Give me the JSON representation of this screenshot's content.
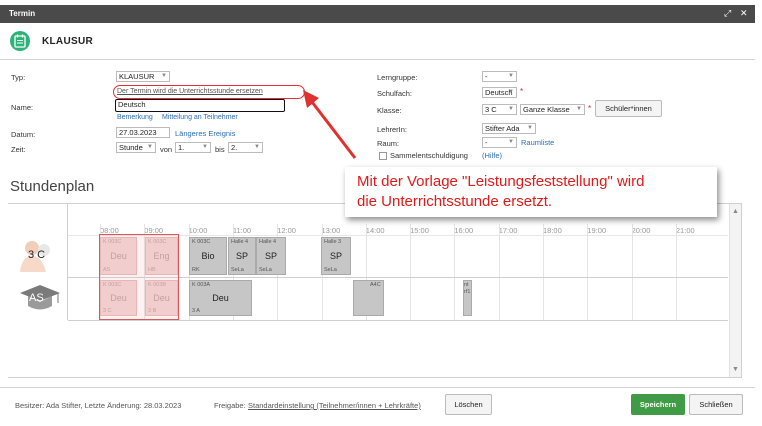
{
  "window": {
    "title": "Termin"
  },
  "header": {
    "title": "KLAUSUR"
  },
  "form": {
    "typ_label": "Typ:",
    "typ_value": "KLAUSUR",
    "replace_link": "Der Termin wird die Unterrichtsstunde ersetzen",
    "name_label": "Name:",
    "name_value": "Deutsch",
    "bemerkung_link": "Bemerkung",
    "mitteilung_link": "Mitteilung an Teilnehmer",
    "datum_label": "Datum:",
    "datum_value": "27.03.2023",
    "laengeres_link": "Längeres Ereignis",
    "zeit_label": "Zeit:",
    "zeit_mode": "Stunde",
    "von_label": "von",
    "von_value": "1.",
    "bis_label": "bis",
    "bis_value": "2.",
    "lerngruppe_label": "Lerngruppe:",
    "lerngruppe_value": "-",
    "schulfach_label": "Schulfach:",
    "schulfach_value": "Deutsch",
    "klasse_label": "Klasse:",
    "klasse_value": "3 C",
    "klasse_mode": "Ganze Klasse",
    "schueler_button": "Schüler*innen",
    "lehrerin_label": "LehrerIn:",
    "lehrerin_value": "Stifter Ada",
    "raum_label": "Raum:",
    "raum_value": "-",
    "raumliste_link": "Raumliste",
    "sammel_label": "Sammelentschuldigung",
    "hilfe_link": "(Hilfe)",
    "required_mark": "*"
  },
  "timetable": {
    "title": "Stundenplan",
    "hours": [
      "08:00",
      "09:00",
      "10:00",
      "11:00",
      "12:00",
      "13:00",
      "14:00",
      "15:00",
      "16:00",
      "17:00",
      "18:00",
      "19:00",
      "20:00",
      "21:00"
    ],
    "rows": [
      {
        "label": "3 C",
        "blocks": [
          {
            "room": "K 003C",
            "subject": "Deu",
            "teacher": "AS",
            "ghost": true
          },
          {
            "room": "K 003C",
            "subject": "Eng",
            "teacher": "HB",
            "ghost": true
          },
          {
            "room": "K 003C",
            "subject": "Bio",
            "teacher": "RK",
            "ghost": false
          },
          {
            "room": "Halle 4",
            "subject": "SP",
            "teacher": "SeLa",
            "ghost": false
          },
          {
            "room": "Halle 4",
            "subject": "SP",
            "teacher": "SeLa",
            "ghost": false
          },
          {
            "room": "Halle 3",
            "subject": "SP",
            "teacher": "SeLa",
            "ghost": false
          }
        ]
      },
      {
        "label": "AS",
        "blocks": [
          {
            "room": "K 003C",
            "subject": "Deu",
            "teacher": "3 C",
            "ghost": true
          },
          {
            "room": "K 003B",
            "subject": "Deu",
            "teacher": "3 B",
            "ghost": true
          },
          {
            "room": "K 003A",
            "subject": "Deu",
            "teacher": "3 A",
            "ghost": false
          },
          {
            "room": "A4C",
            "subject": "",
            "teacher": "",
            "ghost": false
          },
          {
            "room": "nt",
            "subject": "",
            "teacher": "rf1",
            "ghost": false
          }
        ]
      }
    ]
  },
  "callout": {
    "line1": "Mit der Vorlage \"Leistungsfeststellung\" wird",
    "line2": "die Unterrichtsstunde ersetzt."
  },
  "footer": {
    "owner": "Besitzer: Ada Stifter, Letzte Änderung: 28.03.2023",
    "freigabe_label": "Freigabe:",
    "freigabe_link": "Standardeinstellung (Teilnehmer/innen + Lehrkräfte)",
    "delete_button": "Löschen",
    "save_button": "Speichern",
    "close_button": "Schließen"
  },
  "colors": {
    "accent": "#2db37a",
    "save": "#3f9b46",
    "annotation": "#e01919",
    "link": "#2a6ebb"
  }
}
